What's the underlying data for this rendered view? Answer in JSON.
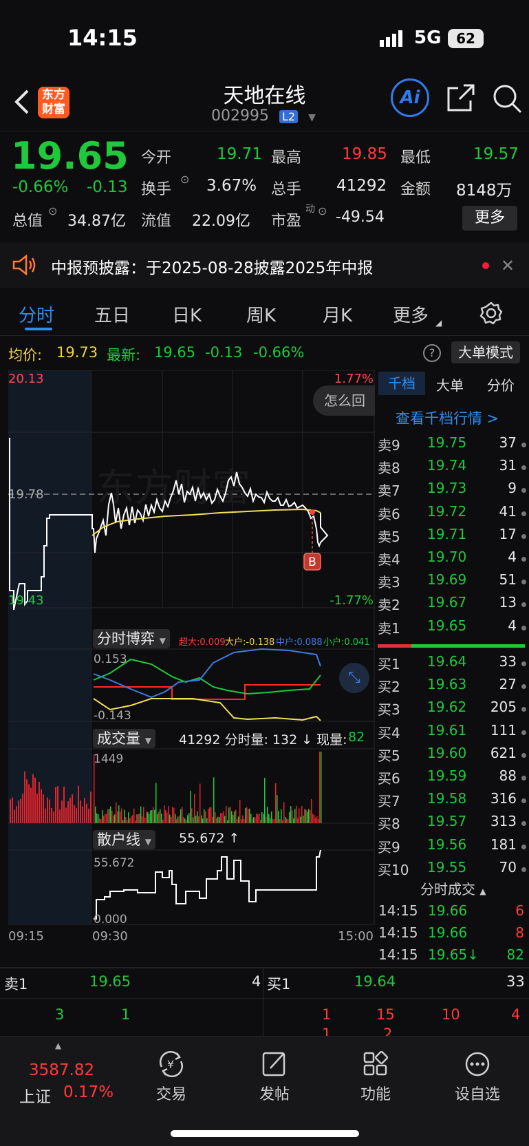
{
  "status": {
    "time": "14:15",
    "network": "5G",
    "battery": "62"
  },
  "header": {
    "logo_line1": "东方",
    "logo_line2": "财富",
    "name": "天地在线",
    "code": "002995",
    "badge": "L2",
    "ai": "Ai"
  },
  "quote": {
    "price": "19.65",
    "pct": "-0.66%",
    "chg": "-0.13",
    "open_label": "今开",
    "open": "19.71",
    "high_label": "最高",
    "high": "19.85",
    "low_label": "最低",
    "low": "19.57",
    "turnover_label": "换手",
    "turnover": "3.67%",
    "vol_label": "总手",
    "vol": "41292",
    "amt_label": "金额",
    "amt": "8148万",
    "mcap_label": "总值",
    "mcap": "34.87亿",
    "float_label": "流值",
    "float": "22.09亿",
    "pe_label": "市盈",
    "pe_sup": "动",
    "pe": "-49.54",
    "more": "更多"
  },
  "notice": {
    "text": "中报预披露：于2025-08-28披露2025年中报"
  },
  "tabs": [
    "分时",
    "五日",
    "日K",
    "周K",
    "月K",
    "更多"
  ],
  "infobar": {
    "avg_label": "均价:",
    "avg": "19.73",
    "last_label": "最新:",
    "last": "19.65",
    "chg": "-0.13",
    "pct": "-0.66%",
    "mode": "大单模式"
  },
  "chart": {
    "max": "20.13",
    "min": "19.43",
    "ref": "19.78",
    "maxpct": "1.77%",
    "minpct": "-1.77%",
    "help": "怎么回",
    "marker": "B",
    "t_start": "09:15",
    "t_open": "09:30",
    "t_end": "15:00"
  },
  "sub1": {
    "title": "分时博弈",
    "l1": "超大:0.009",
    "l2": "大户:-0.138",
    "l3": "中户:0.088",
    "l4": "小户:0.041",
    "top": "0.153",
    "bot": "-0.143"
  },
  "sub2": {
    "title": "成交量",
    "text": "41292 分时量: 132 ↓ 现量:",
    "now": "82",
    "top": "1449"
  },
  "sub3": {
    "title": "散户线",
    "text": "55.672 ↑",
    "top": "55.672",
    "bot": "0.000"
  },
  "book": {
    "tabs": [
      "千档",
      "大单",
      "分价"
    ],
    "link": "查看千档行情 >",
    "asks": [
      [
        "卖9",
        "19.75",
        "37"
      ],
      [
        "卖8",
        "19.74",
        "31"
      ],
      [
        "卖7",
        "19.73",
        "9"
      ],
      [
        "卖6",
        "19.72",
        "41"
      ],
      [
        "卖5",
        "19.71",
        "17"
      ],
      [
        "卖4",
        "19.70",
        "4"
      ],
      [
        "卖3",
        "19.69",
        "51"
      ],
      [
        "卖2",
        "19.67",
        "13"
      ],
      [
        "卖1",
        "19.65",
        "4"
      ]
    ],
    "bids": [
      [
        "买1",
        "19.64",
        "33"
      ],
      [
        "买2",
        "19.63",
        "27"
      ],
      [
        "买3",
        "19.62",
        "205"
      ],
      [
        "买4",
        "19.61",
        "111"
      ],
      [
        "买5",
        "19.60",
        "621"
      ],
      [
        "买6",
        "19.59",
        "88"
      ],
      [
        "买7",
        "19.58",
        "316"
      ],
      [
        "买8",
        "19.57",
        "313"
      ],
      [
        "买9",
        "19.56",
        "181"
      ],
      [
        "买10",
        "19.55",
        "70"
      ]
    ],
    "trades_title": "分时成交",
    "trades": [
      [
        "14:15",
        "19.66",
        "6"
      ],
      [
        "14:15",
        "19.66",
        "8"
      ],
      [
        "14:15",
        "19.65↓",
        "82"
      ]
    ]
  },
  "level": {
    "ask_label": "卖1",
    "ask_price": "19.65",
    "ask_vol": "4",
    "bid_label": "买1",
    "bid_price": "19.64",
    "bid_vol": "33",
    "ask_q": [
      "3",
      "1"
    ],
    "bid_q": [
      "1",
      "15",
      "10",
      "4"
    ],
    "bid_q2": [
      "1",
      "2"
    ]
  },
  "nav": {
    "index": "3587.82",
    "index_name": "上证",
    "index_pct": "0.17%",
    "items": [
      "交易",
      "发帖",
      "功能",
      "设自选"
    ]
  }
}
